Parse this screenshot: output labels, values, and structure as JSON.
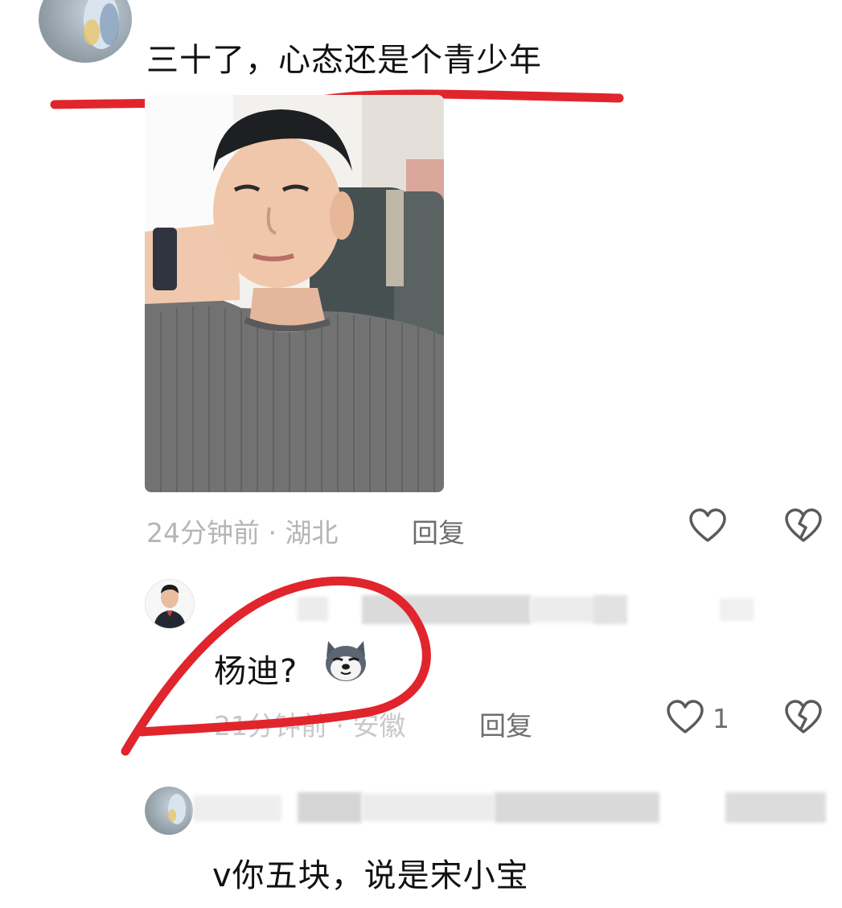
{
  "comment1": {
    "text": "三十了，心态还是个青少年",
    "time_location": "24分钟前 · 湖北",
    "reply_label": "回复"
  },
  "reply1": {
    "text": "杨迪?",
    "emoji": "husky-dog-emoji",
    "time_location": "21分钟前 · 安徽",
    "reply_label": "回复",
    "like_count": "1"
  },
  "reply2": {
    "text": "v你五块，说是宋小宝"
  },
  "colors": {
    "annotation_red": "#e0252c",
    "meta_gray": "#b5b5b5",
    "reply_gray": "#6d6d6d"
  }
}
